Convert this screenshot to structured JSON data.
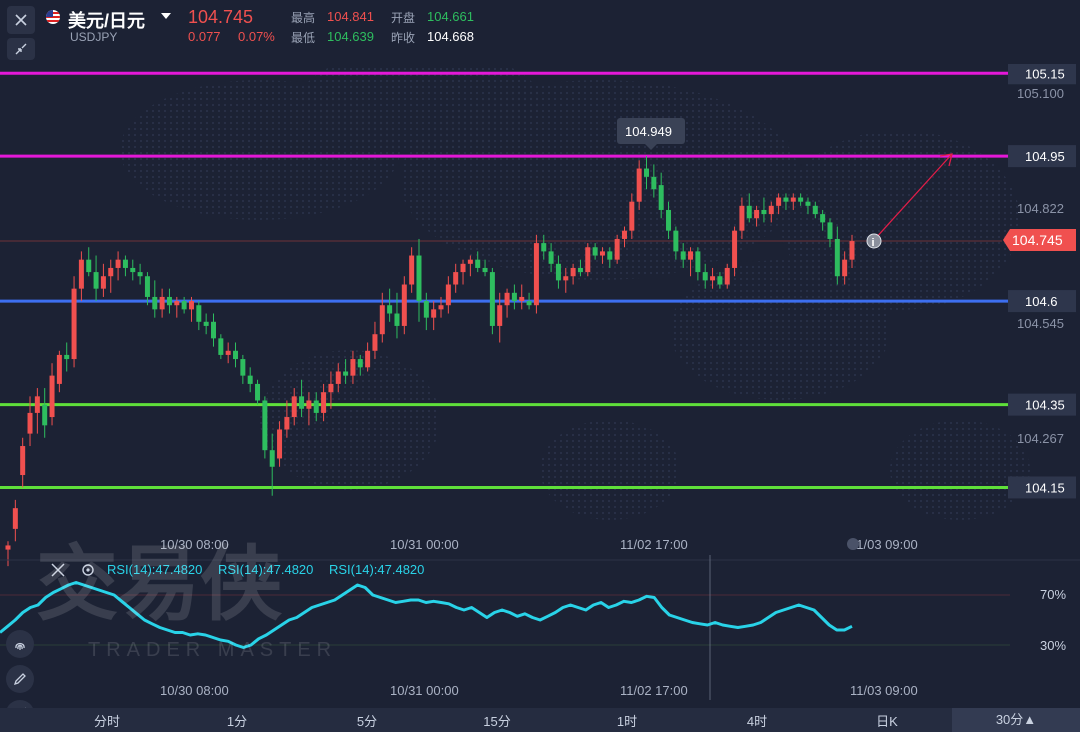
{
  "header": {
    "pair_name": "美元/日元",
    "pair_code": "USDJPY",
    "price": "104.745",
    "change": "0.077",
    "change_pct": "0.07%",
    "high_label": "最高",
    "high_value": "104.841",
    "low_label": "最低",
    "low_value": "104.639",
    "open_label": "开盘",
    "open_value": "104.661",
    "prev_close_label": "昨收",
    "prev_close_value": "104.668",
    "close_icon": "close-icon",
    "collapse_icon": "collapse-icon",
    "flag_icon": "us-flag-icon"
  },
  "colors": {
    "up": "#2ebd5f",
    "down": "#f0504f",
    "magenta": "#e418d8",
    "blue": "#3d6ff0",
    "lime": "#5fe03a",
    "rsi": "#29d3e8",
    "background": "#1c2234"
  },
  "price_axis": {
    "ticks": [
      "105.100",
      "104.822",
      "104.545",
      "104.267"
    ],
    "current_price_tag": "104.745"
  },
  "levels": [
    {
      "value": "105.15",
      "color": "#e418d8"
    },
    {
      "value": "104.95",
      "color": "#e418d8"
    },
    {
      "value": "104.6",
      "color": "#3d6ff0"
    },
    {
      "value": "104.35",
      "color": "#5fe03a"
    },
    {
      "value": "104.15",
      "color": "#5fe03a"
    }
  ],
  "high_tooltip": "104.949",
  "time_axis": {
    "labels": [
      "10/30 08:00",
      "10/31 00:00",
      "11/02 17:00",
      "11/03 09:00"
    ]
  },
  "rsi": {
    "labels": [
      "RSI(14):47.4820",
      "RSI(14):47.4820",
      "RSI(14):47.4820"
    ],
    "levels": [
      "70%",
      "30%"
    ],
    "time_labels": [
      "10/30 08:00",
      "10/31 00:00",
      "11/02 17:00",
      "11/03 09:00"
    ],
    "close_icon": "close-icon",
    "settings_icon": "settings-icon"
  },
  "watermark": {
    "cn": "交易侠",
    "en": "TRADER MASTER"
  },
  "left_tools": [
    "fingerprint-icon",
    "pencil-icon",
    "line-chart-icon"
  ],
  "tabs": [
    "分时",
    "1分",
    "5分",
    "15分",
    "1时",
    "4时",
    "日K",
    "30分▲"
  ],
  "chart_data": {
    "type": "candlestick",
    "instrument": "USDJPY",
    "ylim": [
      104.05,
      105.2
    ],
    "candles": [
      {
        "o": 104.0,
        "h": 104.02,
        "l": 103.96,
        "c": 104.01
      },
      {
        "o": 104.05,
        "h": 104.12,
        "l": 104.02,
        "c": 104.1
      },
      {
        "o": 104.18,
        "h": 104.27,
        "l": 104.15,
        "c": 104.25
      },
      {
        "o": 104.28,
        "h": 104.37,
        "l": 104.25,
        "c": 104.33
      },
      {
        "o": 104.33,
        "h": 104.39,
        "l": 104.28,
        "c": 104.37
      },
      {
        "o": 104.35,
        "h": 104.39,
        "l": 104.27,
        "c": 104.3
      },
      {
        "o": 104.32,
        "h": 104.45,
        "l": 104.3,
        "c": 104.42
      },
      {
        "o": 104.4,
        "h": 104.48,
        "l": 104.38,
        "c": 104.47
      },
      {
        "o": 104.47,
        "h": 104.5,
        "l": 104.43,
        "c": 104.46
      },
      {
        "o": 104.46,
        "h": 104.66,
        "l": 104.44,
        "c": 104.63
      },
      {
        "o": 104.63,
        "h": 104.72,
        "l": 104.6,
        "c": 104.7
      },
      {
        "o": 104.7,
        "h": 104.73,
        "l": 104.66,
        "c": 104.67
      },
      {
        "o": 104.67,
        "h": 104.71,
        "l": 104.6,
        "c": 104.63
      },
      {
        "o": 104.63,
        "h": 104.69,
        "l": 104.61,
        "c": 104.66
      },
      {
        "o": 104.66,
        "h": 104.7,
        "l": 104.62,
        "c": 104.68
      },
      {
        "o": 104.68,
        "h": 104.72,
        "l": 104.65,
        "c": 104.7
      },
      {
        "o": 104.7,
        "h": 104.71,
        "l": 104.66,
        "c": 104.68
      },
      {
        "o": 104.68,
        "h": 104.7,
        "l": 104.65,
        "c": 104.67
      },
      {
        "o": 104.67,
        "h": 104.69,
        "l": 104.64,
        "c": 104.66
      },
      {
        "o": 104.66,
        "h": 104.67,
        "l": 104.59,
        "c": 104.61
      },
      {
        "o": 104.61,
        "h": 104.65,
        "l": 104.56,
        "c": 104.58
      },
      {
        "o": 104.58,
        "h": 104.63,
        "l": 104.56,
        "c": 104.61
      },
      {
        "o": 104.61,
        "h": 104.63,
        "l": 104.57,
        "c": 104.59
      },
      {
        "o": 104.59,
        "h": 104.61,
        "l": 104.56,
        "c": 104.6
      },
      {
        "o": 104.6,
        "h": 104.61,
        "l": 104.57,
        "c": 104.58
      },
      {
        "o": 104.58,
        "h": 104.61,
        "l": 104.55,
        "c": 104.6
      },
      {
        "o": 104.59,
        "h": 104.6,
        "l": 104.53,
        "c": 104.55
      },
      {
        "o": 104.55,
        "h": 104.57,
        "l": 104.52,
        "c": 104.54
      },
      {
        "o": 104.55,
        "h": 104.57,
        "l": 104.49,
        "c": 104.51
      },
      {
        "o": 104.51,
        "h": 104.52,
        "l": 104.46,
        "c": 104.47
      },
      {
        "o": 104.47,
        "h": 104.5,
        "l": 104.45,
        "c": 104.48
      },
      {
        "o": 104.48,
        "h": 104.5,
        "l": 104.44,
        "c": 104.46
      },
      {
        "o": 104.46,
        "h": 104.47,
        "l": 104.4,
        "c": 104.42
      },
      {
        "o": 104.42,
        "h": 104.44,
        "l": 104.38,
        "c": 104.4
      },
      {
        "o": 104.4,
        "h": 104.41,
        "l": 104.35,
        "c": 104.36
      },
      {
        "o": 104.36,
        "h": 104.37,
        "l": 104.22,
        "c": 104.24
      },
      {
        "o": 104.24,
        "h": 104.28,
        "l": 104.13,
        "c": 104.2
      },
      {
        "o": 104.22,
        "h": 104.31,
        "l": 104.2,
        "c": 104.29
      },
      {
        "o": 104.29,
        "h": 104.36,
        "l": 104.27,
        "c": 104.32
      },
      {
        "o": 104.32,
        "h": 104.39,
        "l": 104.3,
        "c": 104.37
      },
      {
        "o": 104.37,
        "h": 104.41,
        "l": 104.32,
        "c": 104.34
      },
      {
        "o": 104.34,
        "h": 104.38,
        "l": 104.3,
        "c": 104.36
      },
      {
        "o": 104.36,
        "h": 104.38,
        "l": 104.31,
        "c": 104.33
      },
      {
        "o": 104.33,
        "h": 104.4,
        "l": 104.31,
        "c": 104.38
      },
      {
        "o": 104.38,
        "h": 104.43,
        "l": 104.34,
        "c": 104.4
      },
      {
        "o": 104.4,
        "h": 104.45,
        "l": 104.38,
        "c": 104.43
      },
      {
        "o": 104.43,
        "h": 104.46,
        "l": 104.4,
        "c": 104.42
      },
      {
        "o": 104.42,
        "h": 104.48,
        "l": 104.4,
        "c": 104.46
      },
      {
        "o": 104.46,
        "h": 104.47,
        "l": 104.42,
        "c": 104.44
      },
      {
        "o": 104.44,
        "h": 104.5,
        "l": 104.43,
        "c": 104.48
      },
      {
        "o": 104.48,
        "h": 104.55,
        "l": 104.46,
        "c": 104.52
      },
      {
        "o": 104.52,
        "h": 104.62,
        "l": 104.5,
        "c": 104.59
      },
      {
        "o": 104.59,
        "h": 104.63,
        "l": 104.55,
        "c": 104.57
      },
      {
        "o": 104.57,
        "h": 104.62,
        "l": 104.51,
        "c": 104.54
      },
      {
        "o": 104.54,
        "h": 104.66,
        "l": 104.52,
        "c": 104.64
      },
      {
        "o": 104.64,
        "h": 104.73,
        "l": 104.62,
        "c": 104.71
      },
      {
        "o": 104.71,
        "h": 104.75,
        "l": 104.55,
        "c": 104.6
      },
      {
        "o": 104.6,
        "h": 104.62,
        "l": 104.53,
        "c": 104.56
      },
      {
        "o": 104.56,
        "h": 104.6,
        "l": 104.53,
        "c": 104.58
      },
      {
        "o": 104.58,
        "h": 104.61,
        "l": 104.56,
        "c": 104.59
      },
      {
        "o": 104.59,
        "h": 104.66,
        "l": 104.57,
        "c": 104.64
      },
      {
        "o": 104.64,
        "h": 104.69,
        "l": 104.62,
        "c": 104.67
      },
      {
        "o": 104.67,
        "h": 104.7,
        "l": 104.64,
        "c": 104.69
      },
      {
        "o": 104.69,
        "h": 104.71,
        "l": 104.66,
        "c": 104.7
      },
      {
        "o": 104.7,
        "h": 104.72,
        "l": 104.67,
        "c": 104.68
      },
      {
        "o": 104.68,
        "h": 104.7,
        "l": 104.66,
        "c": 104.67
      },
      {
        "o": 104.67,
        "h": 104.68,
        "l": 104.52,
        "c": 104.54
      },
      {
        "o": 104.54,
        "h": 104.62,
        "l": 104.5,
        "c": 104.59
      },
      {
        "o": 104.59,
        "h": 104.63,
        "l": 104.56,
        "c": 104.62
      },
      {
        "o": 104.62,
        "h": 104.64,
        "l": 104.58,
        "c": 104.6
      },
      {
        "o": 104.6,
        "h": 104.64,
        "l": 104.58,
        "c": 104.61
      },
      {
        "o": 104.6,
        "h": 104.62,
        "l": 104.58,
        "c": 104.59
      },
      {
        "o": 104.59,
        "h": 104.76,
        "l": 104.57,
        "c": 104.74
      },
      {
        "o": 104.74,
        "h": 104.76,
        "l": 104.7,
        "c": 104.72
      },
      {
        "o": 104.72,
        "h": 104.74,
        "l": 104.67,
        "c": 104.69
      },
      {
        "o": 104.69,
        "h": 104.71,
        "l": 104.63,
        "c": 104.65
      },
      {
        "o": 104.65,
        "h": 104.68,
        "l": 104.62,
        "c": 104.66
      },
      {
        "o": 104.66,
        "h": 104.69,
        "l": 104.64,
        "c": 104.68
      },
      {
        "o": 104.68,
        "h": 104.7,
        "l": 104.66,
        "c": 104.67
      },
      {
        "o": 104.67,
        "h": 104.74,
        "l": 104.66,
        "c": 104.73
      },
      {
        "o": 104.73,
        "h": 104.74,
        "l": 104.7,
        "c": 104.71
      },
      {
        "o": 104.71,
        "h": 104.73,
        "l": 104.69,
        "c": 104.72
      },
      {
        "o": 104.72,
        "h": 104.73,
        "l": 104.68,
        "c": 104.7
      },
      {
        "o": 104.7,
        "h": 104.76,
        "l": 104.69,
        "c": 104.75
      },
      {
        "o": 104.75,
        "h": 104.78,
        "l": 104.73,
        "c": 104.77
      },
      {
        "o": 104.77,
        "h": 104.86,
        "l": 104.75,
        "c": 104.84
      },
      {
        "o": 104.84,
        "h": 104.94,
        "l": 104.82,
        "c": 104.92
      },
      {
        "o": 104.92,
        "h": 104.95,
        "l": 104.87,
        "c": 104.9
      },
      {
        "o": 104.9,
        "h": 104.93,
        "l": 104.85,
        "c": 104.87
      },
      {
        "o": 104.88,
        "h": 104.91,
        "l": 104.8,
        "c": 104.82
      },
      {
        "o": 104.82,
        "h": 104.84,
        "l": 104.75,
        "c": 104.77
      },
      {
        "o": 104.77,
        "h": 104.78,
        "l": 104.7,
        "c": 104.72
      },
      {
        "o": 104.72,
        "h": 104.74,
        "l": 104.68,
        "c": 104.7
      },
      {
        "o": 104.7,
        "h": 104.73,
        "l": 104.66,
        "c": 104.72
      },
      {
        "o": 104.72,
        "h": 104.73,
        "l": 104.65,
        "c": 104.67
      },
      {
        "o": 104.67,
        "h": 104.69,
        "l": 104.63,
        "c": 104.65
      },
      {
        "o": 104.65,
        "h": 104.68,
        "l": 104.63,
        "c": 104.66
      },
      {
        "o": 104.66,
        "h": 104.67,
        "l": 104.63,
        "c": 104.64
      },
      {
        "o": 104.64,
        "h": 104.69,
        "l": 104.63,
        "c": 104.68
      },
      {
        "o": 104.68,
        "h": 104.78,
        "l": 104.66,
        "c": 104.77
      },
      {
        "o": 104.77,
        "h": 104.85,
        "l": 104.75,
        "c": 104.83
      },
      {
        "o": 104.83,
        "h": 104.86,
        "l": 104.79,
        "c": 104.8
      },
      {
        "o": 104.8,
        "h": 104.83,
        "l": 104.78,
        "c": 104.82
      },
      {
        "o": 104.82,
        "h": 104.85,
        "l": 104.79,
        "c": 104.81
      },
      {
        "o": 104.81,
        "h": 104.84,
        "l": 104.79,
        "c": 104.83
      },
      {
        "o": 104.83,
        "h": 104.86,
        "l": 104.81,
        "c": 104.85
      },
      {
        "o": 104.85,
        "h": 104.86,
        "l": 104.82,
        "c": 104.84
      },
      {
        "o": 104.84,
        "h": 104.86,
        "l": 104.82,
        "c": 104.85
      },
      {
        "o": 104.85,
        "h": 104.86,
        "l": 104.83,
        "c": 104.84
      },
      {
        "o": 104.84,
        "h": 104.85,
        "l": 104.81,
        "c": 104.83
      },
      {
        "o": 104.83,
        "h": 104.84,
        "l": 104.8,
        "c": 104.81
      },
      {
        "o": 104.81,
        "h": 104.82,
        "l": 104.77,
        "c": 104.79
      },
      {
        "o": 104.79,
        "h": 104.8,
        "l": 104.73,
        "c": 104.75
      },
      {
        "o": 104.75,
        "h": 104.78,
        "l": 104.64,
        "c": 104.66
      },
      {
        "o": 104.66,
        "h": 104.72,
        "l": 104.64,
        "c": 104.7
      },
      {
        "o": 104.7,
        "h": 104.76,
        "l": 104.68,
        "c": 104.745
      }
    ],
    "rsi": [
      40,
      45,
      50,
      56,
      60,
      62,
      68,
      72,
      75,
      78,
      80,
      78,
      76,
      74,
      72,
      70,
      65,
      60,
      55,
      50,
      47,
      44,
      42,
      40,
      40,
      38,
      39,
      38,
      36,
      34,
      33,
      30,
      28,
      30,
      35,
      38,
      42,
      46,
      50,
      52,
      56,
      60,
      62,
      64,
      66,
      70,
      74,
      78,
      76,
      70,
      68,
      66,
      64,
      65,
      66,
      66,
      64,
      65,
      64,
      63,
      60,
      58,
      60,
      56,
      52,
      56,
      58,
      56,
      53,
      55,
      52,
      50,
      53,
      56,
      60,
      62,
      60,
      58,
      62,
      64,
      60,
      62,
      65,
      64,
      66,
      69,
      68,
      60,
      54,
      52,
      50,
      48,
      47,
      46,
      48,
      46,
      45,
      44,
      45,
      46,
      48,
      52,
      56,
      58,
      60,
      62,
      60,
      58,
      52,
      46,
      42,
      42,
      45
    ],
    "rsi_levels": [
      70,
      30
    ]
  }
}
